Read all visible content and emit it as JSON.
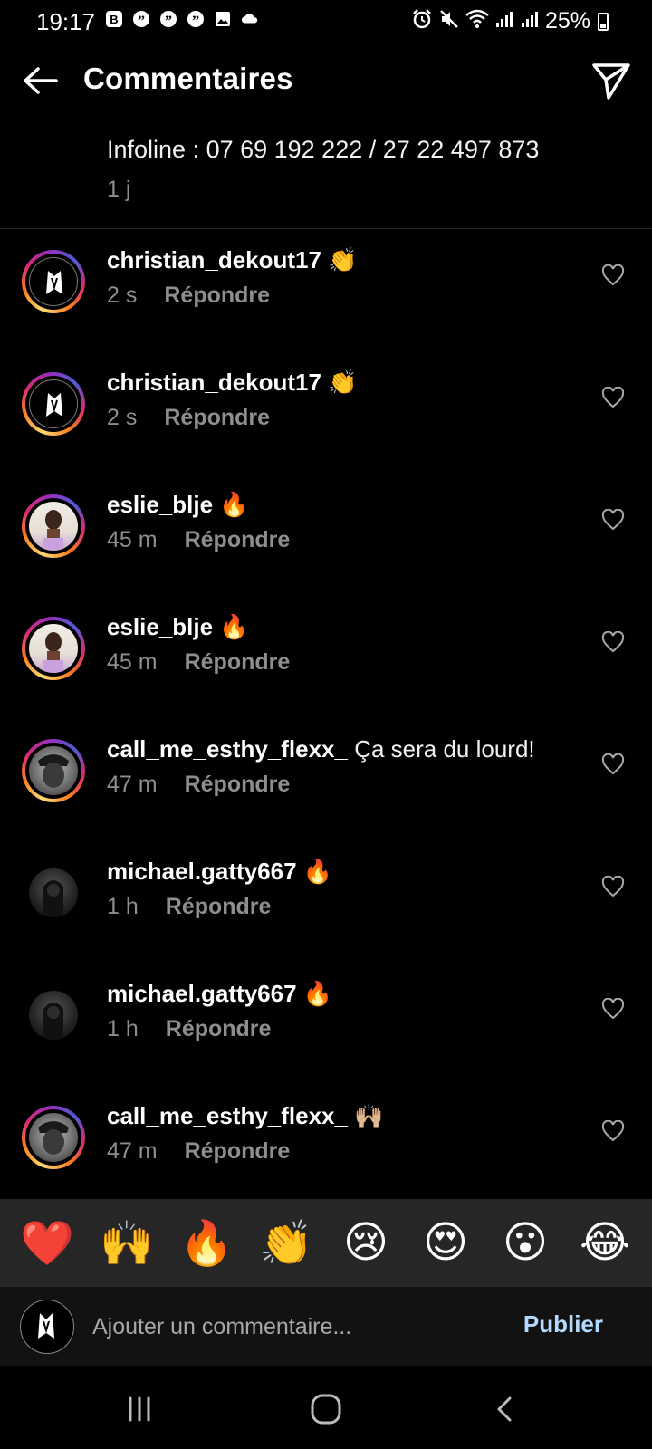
{
  "status_bar": {
    "time": "19:17",
    "battery": "25%",
    "notification_icons": [
      "b-icon",
      "quote-icon",
      "quote-icon",
      "quote-icon",
      "gallery-icon",
      "cloud-icon"
    ],
    "system_icons": [
      "alarm-icon",
      "mute-icon",
      "wifi-icon",
      "signal-icon",
      "signal-icon"
    ]
  },
  "header": {
    "title": "Commentaires"
  },
  "caption": {
    "text": "Infoline : 07 69 192 222 / 27 22 497 873",
    "time": "1 j"
  },
  "comments": [
    {
      "username": "christian_dekout17",
      "text": "👏",
      "time": "2 s",
      "reply": "Répondre"
    },
    {
      "username": "christian_dekout17",
      "text": "👏",
      "time": "2 s",
      "reply": "Répondre"
    },
    {
      "username": "eslie_blje",
      "text": "🔥",
      "time": "45 m",
      "reply": "Répondre"
    },
    {
      "username": "eslie_blje",
      "text": "🔥",
      "time": "45 m",
      "reply": "Répondre"
    },
    {
      "username": "call_me_esthy_flexx_",
      "text": "Ça sera du lourd!",
      "time": "47 m",
      "reply": "Répondre"
    },
    {
      "username": "michael.gatty667",
      "text": "🔥",
      "time": "1 h",
      "reply": "Répondre"
    },
    {
      "username": "michael.gatty667",
      "text": "🔥",
      "time": "1 h",
      "reply": "Répondre"
    },
    {
      "username": "call_me_esthy_flexx_",
      "text": "🙌🏼",
      "time": "47 m",
      "reply": "Répondre"
    }
  ],
  "emoji_bar": [
    "❤️",
    "🙌",
    "🔥",
    "👏",
    "😢",
    "😍",
    "😮",
    "😂"
  ],
  "comment_input": {
    "placeholder": "Ajouter un commentaire...",
    "publish_label": "Publier"
  },
  "colors": {
    "background": "#000000",
    "secondary_text": "#8e8e8e",
    "publish": "#b3dbff",
    "emoji_bar_bg": "#262626"
  }
}
